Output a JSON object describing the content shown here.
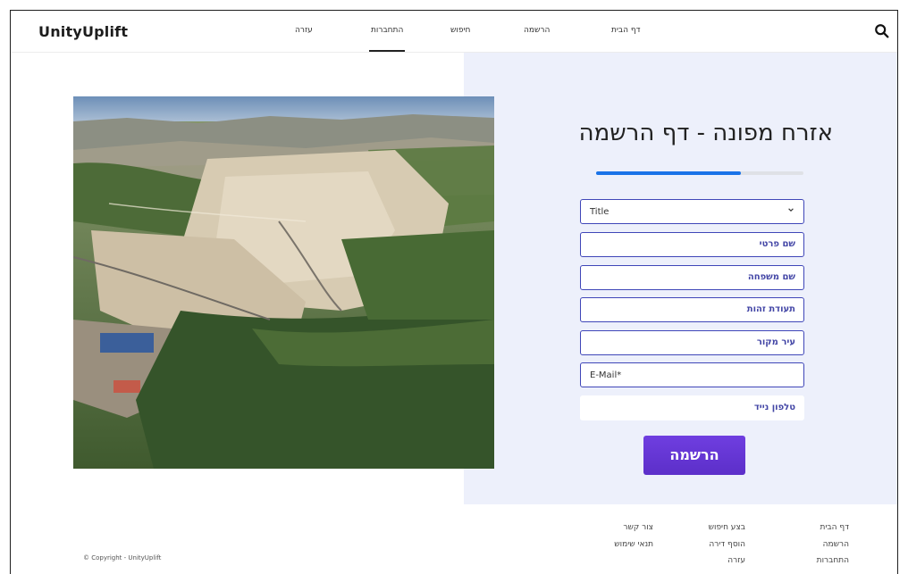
{
  "brand": {
    "logo": "UnityUplift"
  },
  "nav": [
    {
      "label": "דף הבית"
    },
    {
      "label": "הרשמה"
    },
    {
      "label": "חיפוש"
    },
    {
      "label": "התחברות",
      "active": true
    },
    {
      "label": "עזרה"
    }
  ],
  "form": {
    "title": "אזרח מפונה - דף הרשמה",
    "progress": 0.7,
    "title_select": {
      "value": "Title"
    },
    "first_name": {
      "placeholder": "שם פרטי"
    },
    "last_name": {
      "placeholder": "שם משפחה"
    },
    "id_number": {
      "placeholder": "תעודת זהות"
    },
    "origin_city": {
      "placeholder": "עיר מקור"
    },
    "email": {
      "placeholder": "E-Mail*"
    },
    "phone": {
      "placeholder": "טלפון נייד"
    },
    "submit_label": "הרשמה"
  },
  "footer": {
    "col1": [
      "דף הבית",
      "הרשמה",
      "התחברות"
    ],
    "col2": [
      "בצע חיפוש",
      "הוסף דירה",
      "עזרה"
    ],
    "col3": [
      "צור קשר",
      "תנאי שימוש"
    ],
    "copyright": "© Copyright - UnityUplift"
  },
  "icons": {
    "search": "search-icon",
    "dropdown": "chevron-down-icon"
  },
  "colors": {
    "accent": "#1a73e8",
    "button": "#5c2fc9",
    "panel": "#edf0fb",
    "field_text": "#4346a6"
  }
}
